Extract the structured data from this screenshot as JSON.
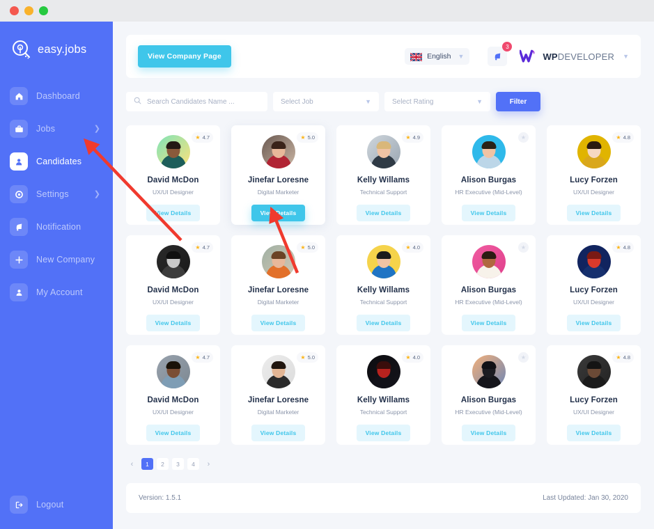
{
  "window": {
    "dots": [
      "close",
      "minimize",
      "maximize"
    ]
  },
  "sidebar": {
    "brand": "easy.jobs",
    "items": [
      {
        "label": "Dashboard",
        "icon": "home-icon",
        "active": false,
        "chevron": false
      },
      {
        "label": "Jobs",
        "icon": "briefcase-icon",
        "active": false,
        "chevron": true
      },
      {
        "label": "Candidates",
        "icon": "user-card-icon",
        "active": true,
        "chevron": false
      },
      {
        "label": "Settings",
        "icon": "gear-icon",
        "active": false,
        "chevron": true
      },
      {
        "label": "Notification",
        "icon": "bell-icon",
        "active": false,
        "chevron": false
      },
      {
        "label": "New Company",
        "icon": "plus-icon",
        "active": false,
        "chevron": false
      },
      {
        "label": "My Account",
        "icon": "person-icon",
        "active": false,
        "chevron": false
      }
    ],
    "logout": {
      "label": "Logout",
      "icon": "logout-icon"
    }
  },
  "header": {
    "company_button": "View Company Page",
    "language": {
      "label": "English",
      "flag": "uk-flag-icon",
      "caret": "chevron-down-icon"
    },
    "notifications": {
      "icon": "bell-icon",
      "count": "3"
    },
    "account": {
      "brand_bold": "WP",
      "brand_light": "DEVELOPER",
      "logo": "wpdeveloper-logo-icon",
      "caret": "chevron-down-icon"
    }
  },
  "filters": {
    "search_placeholder": "Search Candidates Name ...",
    "search_value": "",
    "job_select": "Select Job",
    "rating_select": "Select Rating",
    "filter_button": "Filter"
  },
  "candidates": [
    {
      "name": "David McDon",
      "role": "UX/UI Designer",
      "rating": "4.7",
      "rated": true,
      "button": "View Details",
      "selected": false,
      "avatar": {
        "bg": "#7fe3b8,#ffe27a",
        "skin": "#8a5a3b",
        "hair": "#241a15",
        "shirt": "#1d5e5a"
      }
    },
    {
      "name": "Jinefar Loresne",
      "role": "Digital Marketer",
      "rating": "5.0",
      "rated": true,
      "button": "View Details",
      "selected": true,
      "avatar": {
        "bg": "#6b5a52,#cbb6a4",
        "skin": "#e8b89a",
        "hair": "#3a2319",
        "shirt": "#b12434"
      }
    },
    {
      "name": "Kelly Willams",
      "role": "Technical Support",
      "rating": "4.9",
      "rated": true,
      "button": "View Details",
      "selected": false,
      "avatar": {
        "bg": "#cfd6dc,#9aa6b2",
        "skin": "#f0c3a4",
        "hair": "#d9b779",
        "shirt": "#2f3a45"
      }
    },
    {
      "name": "Alison Burgas",
      "role": "HR Executive (Mid-Level)",
      "rating": "",
      "rated": false,
      "button": "View Details",
      "selected": false,
      "avatar": {
        "bg": "#2fb9ea,#2fb9ea",
        "skin": "#f0c3a4",
        "hair": "#2a2117",
        "shirt": "#bcd6e8"
      }
    },
    {
      "name": "Lucy Forzen",
      "role": "UX/UI Designer",
      "rating": "4.8",
      "rated": true,
      "button": "View Details",
      "selected": false,
      "avatar": {
        "bg": "#e0b400,#e0b400",
        "skin": "#f6d8c2",
        "hair": "#2c1b10",
        "shirt": "#d9a71c"
      }
    },
    {
      "name": "David McDon",
      "role": "UX/UI Designer",
      "rating": "4.7",
      "rated": true,
      "button": "View Details",
      "selected": false,
      "avatar": {
        "bg": "#2a2a2a,#1a1a1a",
        "skin": "#c9c9c9",
        "hair": "#101010",
        "shirt": "#3c3c3c"
      }
    },
    {
      "name": "Jinefar Loresne",
      "role": "Digital Marketer",
      "rating": "5.0",
      "rated": true,
      "button": "View Details",
      "selected": false,
      "avatar": {
        "bg": "#9fb0a4,#d6c9b4",
        "skin": "#e8b89a",
        "hair": "#6b4326",
        "shirt": "#e2702a"
      }
    },
    {
      "name": "Kelly Willams",
      "role": "Technical Support",
      "rating": "4.0",
      "rated": true,
      "button": "View Details",
      "selected": false,
      "avatar": {
        "bg": "#f5d34b,#f5d34b",
        "skin": "#f0c3a4",
        "hair": "#1c1c1c",
        "shirt": "#1f74c4"
      }
    },
    {
      "name": "Alison Burgas",
      "role": "HR Executive (Mid-Level)",
      "rating": "",
      "rated": false,
      "button": "View Details",
      "selected": false,
      "avatar": {
        "bg": "#f05ba0,#e0408c",
        "skin": "#b06840",
        "hair": "#2b1c12",
        "shirt": "#f7f2ea"
      }
    },
    {
      "name": "Lucy Forzen",
      "role": "UX/UI Designer",
      "rating": "4.8",
      "rated": true,
      "button": "View Details",
      "selected": false,
      "avatar": {
        "bg": "#11245f,#11245f",
        "skin": "#d93a2b",
        "hair": "#7a1a14",
        "shirt": "#16306e"
      }
    },
    {
      "name": "David McDon",
      "role": "UX/UI Designer",
      "rating": "4.7",
      "rated": true,
      "button": "View Details",
      "selected": false,
      "avatar": {
        "bg": "#98a2ad,#7d8892",
        "skin": "#7a4e35",
        "hair": "#1a1208",
        "shirt": "#7e9db5"
      }
    },
    {
      "name": "Jinefar Loresne",
      "role": "Digital Marketer",
      "rating": "5.0",
      "rated": true,
      "button": "View Details",
      "selected": false,
      "avatar": {
        "bg": "#ececec,#dcdcdc",
        "skin": "#e3b695",
        "hair": "#20160f",
        "shirt": "#2b2b2b"
      }
    },
    {
      "name": "Kelly Willams",
      "role": "Technical Support",
      "rating": "4.0",
      "rated": true,
      "button": "View Details",
      "selected": false,
      "avatar": {
        "bg": "#0c0c10,#15151c",
        "skin": "#b8221e",
        "hair": "#3a0d0b",
        "shirt": "#121219"
      }
    },
    {
      "name": "Alison Burgas",
      "role": "HR Executive (Mid-Level)",
      "rating": "",
      "rated": false,
      "button": "View Details",
      "selected": false,
      "avatar": {
        "bg": "#f3b07a,#6f87b5",
        "skin": "#1c1c22",
        "hair": "#111116",
        "shirt": "#15151b"
      }
    },
    {
      "name": "Lucy Forzen",
      "role": "UX/UI Designer",
      "rating": "4.8",
      "rated": true,
      "button": "View Details",
      "selected": false,
      "avatar": {
        "bg": "#3a3a3a,#232323",
        "skin": "#6b4a36",
        "hair": "#141414",
        "shirt": "#1b1b1b"
      }
    }
  ],
  "pagination": {
    "prev": "‹",
    "pages": [
      "1",
      "2",
      "3",
      "4"
    ],
    "current": "1",
    "next": "›"
  },
  "footer": {
    "version": "Version: 1.5.1",
    "last_updated": "Last Updated: Jan 30, 2020"
  },
  "colors": {
    "sidebar": "#5271f7",
    "accent_blue": "#5271f7",
    "accent_cyan": "#3fc6ea",
    "page_bg": "#f4f6fa",
    "badge_red": "#f04a6e",
    "star_gold": "#fcb415"
  }
}
